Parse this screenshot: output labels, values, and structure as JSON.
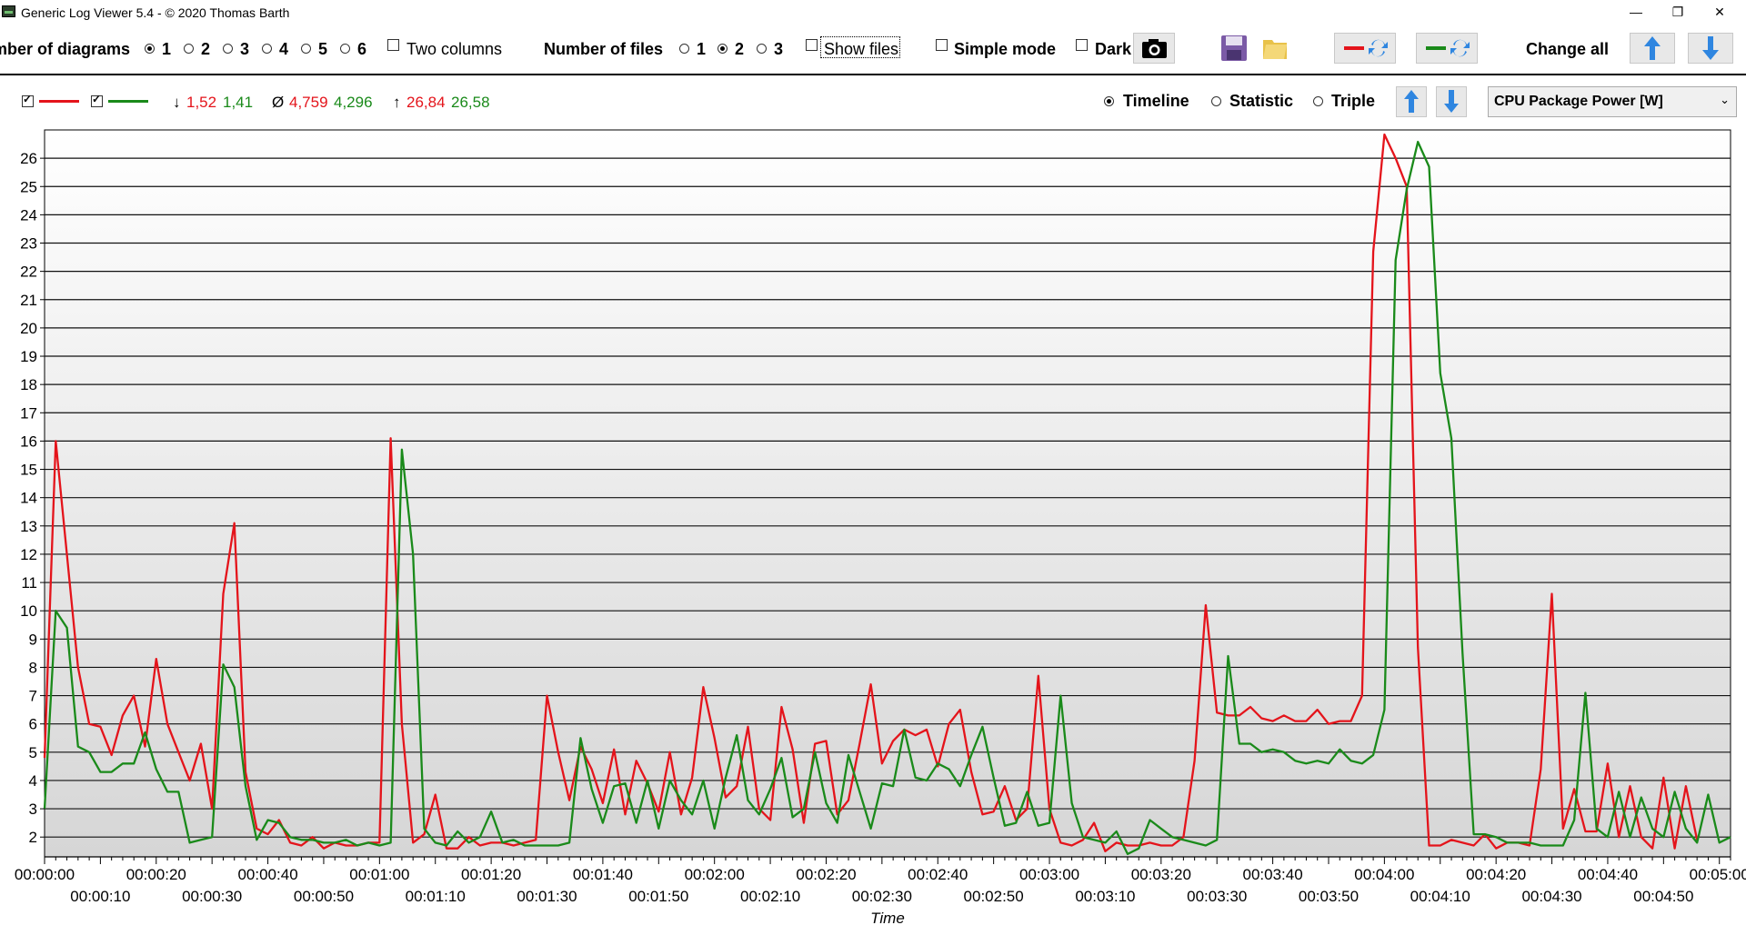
{
  "window": {
    "title": "Generic Log Viewer 5.4 - © 2020 Thomas Barth",
    "controls": {
      "minimize": "—",
      "restore": "❐",
      "close": "✕"
    }
  },
  "toolbar": {
    "diagrams_label": "Number of diagrams",
    "diagrams_options": [
      "1",
      "2",
      "3",
      "4",
      "5",
      "6"
    ],
    "diagrams_selected": "1",
    "two_columns": "Two columns",
    "files_label": "Number of files",
    "files_options": [
      "1",
      "2",
      "3"
    ],
    "files_selected": "2",
    "show_files": "Show files",
    "simple_mode": "Simple mode",
    "dark": "Dark",
    "change_all": "Change all"
  },
  "legend": {
    "min_arrow": "↓",
    "min_red": "1,52",
    "min_green": "1,41",
    "avg_symbol": "Ø",
    "avg_red": "4,759",
    "avg_green": "4,296",
    "max_arrow": "↑",
    "max_red": "26,84",
    "max_green": "26,58",
    "view_timeline": "Timeline",
    "view_statistic": "Statistic",
    "view_triple": "Triple",
    "view_selected": "Timeline",
    "sensor": "CPU Package Power [W]"
  },
  "colors": {
    "red": "#e4141b",
    "green": "#1a8a1a",
    "blue": "#2f86e0"
  },
  "icons": [
    "camera-icon",
    "save-icon",
    "folder-icon",
    "red-swap-icon",
    "green-swap-icon",
    "arrow-up-icon",
    "arrow-down-icon",
    "chevron-down-icon"
  ],
  "chart_data": {
    "type": "line",
    "xlabel": "Time",
    "ylabel": "",
    "y_ticks": [
      2,
      3,
      4,
      5,
      6,
      7,
      8,
      9,
      10,
      11,
      12,
      13,
      14,
      15,
      16,
      17,
      18,
      19,
      20,
      21,
      22,
      23,
      24,
      25,
      26
    ],
    "ylim": [
      1.3,
      27.0
    ],
    "xlim": [
      0,
      302
    ],
    "x_ticks_upper": [
      "00:00:00",
      "00:00:20",
      "00:00:40",
      "00:01:00",
      "00:01:20",
      "00:01:40",
      "00:02:00",
      "00:02:20",
      "00:02:40",
      "00:03:00",
      "00:03:20",
      "00:03:40",
      "00:04:00",
      "00:04:20",
      "00:04:40",
      "00:05:00"
    ],
    "x_ticks_lower": [
      "00:00:10",
      "00:00:30",
      "00:00:50",
      "00:01:10",
      "00:01:30",
      "00:01:50",
      "00:02:10",
      "00:02:30",
      "00:02:50",
      "00:03:10",
      "00:03:30",
      "00:03:50",
      "00:04:10",
      "00:04:30",
      "00:04:50"
    ],
    "grid": true,
    "series": [
      {
        "color": "#e4141b",
        "t": [
          0,
          2,
          6,
          8,
          10,
          12,
          14,
          16,
          18,
          20,
          22,
          24,
          26,
          28,
          30,
          32,
          34,
          36,
          38,
          40,
          42,
          44,
          46,
          48,
          50,
          52,
          54,
          56,
          58,
          60,
          62,
          64,
          66,
          68,
          70,
          72,
          74,
          76,
          78,
          80,
          82,
          84,
          86,
          88,
          90,
          92,
          94,
          96,
          98,
          100,
          102,
          104,
          106,
          108,
          110,
          112,
          114,
          116,
          118,
          120,
          122,
          124,
          126,
          128,
          130,
          132,
          134,
          136,
          138,
          140,
          142,
          144,
          146,
          148,
          150,
          152,
          154,
          156,
          158,
          160,
          162,
          164,
          166,
          168,
          170,
          172,
          174,
          176,
          178,
          180,
          182,
          184,
          186,
          188,
          190,
          192,
          194,
          196,
          198,
          200,
          202,
          204,
          206,
          208,
          210,
          212,
          214,
          216,
          218,
          220,
          222,
          224,
          226,
          228,
          230,
          232,
          234,
          236,
          238,
          240,
          242,
          244,
          246,
          248,
          250,
          252,
          254,
          256,
          258,
          260,
          262,
          264,
          266,
          268,
          270,
          272,
          274,
          276,
          278,
          280,
          282,
          284,
          286,
          288,
          290,
          292,
          294,
          296,
          298,
          300,
          302
        ],
        "values": [
          4.8,
          16.0,
          8.0,
          6.0,
          5.9,
          4.9,
          6.3,
          7.0,
          5.2,
          8.3,
          6.0,
          5.0,
          4.0,
          5.3,
          3.0,
          10.6,
          13.1,
          4.3,
          2.3,
          2.1,
          2.6,
          1.8,
          1.7,
          2.0,
          1.6,
          1.8,
          1.7,
          1.7,
          1.8,
          1.8,
          16.1,
          6.0,
          1.8,
          2.1,
          3.5,
          1.6,
          1.6,
          2.0,
          1.7,
          1.8,
          1.8,
          1.7,
          1.8,
          1.9,
          7.0,
          5.0,
          3.3,
          5.2,
          4.4,
          3.2,
          5.1,
          2.8,
          4.7,
          3.9,
          2.9,
          5.0,
          2.8,
          4.1,
          7.3,
          5.5,
          3.4,
          3.8,
          5.9,
          3.0,
          2.6,
          6.6,
          5.1,
          2.5,
          5.3,
          5.4,
          2.8,
          3.3,
          5.3,
          7.4,
          4.6,
          5.4,
          5.8,
          5.6,
          5.8,
          4.5,
          6.0,
          6.5,
          4.3,
          2.8,
          2.9,
          3.8,
          2.6,
          3.0,
          7.7,
          3.0,
          1.8,
          1.7,
          1.9,
          2.5,
          1.5,
          1.8,
          1.7,
          1.7,
          1.8,
          1.7,
          1.7,
          2.0,
          4.7,
          10.2,
          6.4,
          6.3,
          6.3,
          6.6,
          6.2,
          6.1,
          6.3,
          6.1,
          6.1,
          6.5,
          6.0,
          6.1,
          6.1,
          7.0,
          22.7,
          26.84,
          26.0,
          25.0,
          8.7,
          1.7,
          1.7,
          1.9,
          1.8,
          1.7,
          2.1,
          1.6,
          1.8,
          1.8,
          1.7,
          4.4,
          10.6,
          2.3,
          3.7,
          2.2,
          2.2,
          4.6,
          2.0,
          3.8,
          2.0,
          1.6,
          4.1,
          1.6,
          3.8,
          1.9
        ]
      },
      {
        "color": "#1a8a1a",
        "t": [
          0,
          2,
          4,
          6,
          8,
          10,
          12,
          14,
          16,
          18,
          20,
          22,
          24,
          26,
          28,
          30,
          32,
          34,
          36,
          38,
          40,
          42,
          44,
          46,
          48,
          50,
          52,
          54,
          56,
          58,
          60,
          62,
          64,
          66,
          68,
          70,
          72,
          74,
          76,
          78,
          80,
          82,
          84,
          86,
          88,
          90,
          92,
          94,
          96,
          98,
          100,
          102,
          104,
          106,
          108,
          110,
          112,
          114,
          116,
          118,
          120,
          122,
          124,
          126,
          128,
          130,
          132,
          134,
          136,
          138,
          140,
          142,
          144,
          146,
          148,
          150,
          152,
          154,
          156,
          158,
          160,
          162,
          164,
          166,
          168,
          170,
          172,
          174,
          176,
          178,
          180,
          182,
          184,
          186,
          188,
          190,
          192,
          194,
          196,
          198,
          200,
          202,
          204,
          206,
          208,
          210,
          212,
          214,
          216,
          218,
          220,
          222,
          224,
          226,
          228,
          230,
          232,
          234,
          236,
          238,
          240,
          242,
          244,
          246,
          248,
          250,
          252,
          254,
          256,
          258,
          260,
          262,
          264,
          266,
          268,
          270,
          272,
          274,
          276,
          278,
          280,
          282,
          284,
          286,
          288,
          290,
          292,
          294,
          296,
          298,
          300,
          302
        ],
        "values": [
          3.0,
          10.0,
          9.4,
          5.2,
          5.0,
          4.3,
          4.3,
          4.6,
          4.6,
          5.7,
          4.4,
          3.6,
          3.6,
          1.8,
          1.9,
          2.0,
          8.1,
          7.3,
          3.8,
          1.9,
          2.6,
          2.5,
          2.0,
          1.9,
          1.9,
          1.8,
          1.8,
          1.9,
          1.7,
          1.8,
          1.7,
          1.8,
          15.7,
          12.0,
          2.3,
          1.8,
          1.7,
          2.2,
          1.8,
          2.0,
          2.9,
          1.8,
          1.9,
          1.7,
          1.7,
          1.7,
          1.7,
          1.8,
          5.5,
          3.7,
          2.5,
          3.8,
          3.9,
          2.5,
          4.0,
          2.3,
          4.0,
          3.3,
          2.8,
          4.0,
          2.3,
          4.1,
          5.6,
          3.3,
          2.8,
          3.7,
          4.8,
          2.7,
          3.0,
          5.0,
          3.2,
          2.5,
          4.9,
          3.6,
          2.3,
          3.9,
          3.8,
          5.8,
          4.1,
          4.0,
          4.6,
          4.4,
          3.8,
          4.9,
          5.9,
          4.1,
          2.4,
          2.5,
          3.6,
          2.4,
          2.5,
          7.0,
          3.2,
          2.0,
          1.9,
          1.8,
          2.2,
          1.4,
          1.6,
          2.6,
          2.3,
          2.0,
          1.9,
          1.8,
          1.7,
          1.9,
          8.4,
          5.3,
          5.3,
          5.0,
          5.1,
          5.0,
          4.7,
          4.6,
          4.7,
          4.6,
          5.1,
          4.7,
          4.6,
          4.9,
          6.5,
          22.4,
          24.9,
          26.58,
          25.7,
          18.4,
          16.1,
          8.5,
          2.1,
          2.1,
          2.0,
          1.8,
          1.8,
          1.8,
          1.7,
          1.7,
          1.7,
          2.6,
          7.1,
          2.3,
          2.0,
          3.6,
          2.0,
          3.4,
          2.3,
          2.0,
          3.6,
          2.3,
          1.8,
          3.5,
          1.8,
          2.0,
          2.8
        ]
      }
    ]
  }
}
